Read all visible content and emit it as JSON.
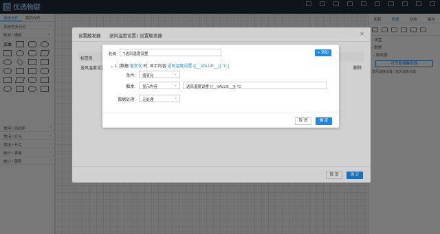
{
  "app": {
    "logo_text": "优选物联",
    "toolbar": [
      {
        "label": "",
        "icon": "undo-icon"
      },
      {
        "label": "",
        "icon": "redo-icon"
      },
      {
        "label": "",
        "icon": "copy-icon"
      },
      {
        "label": "",
        "icon": "paste-icon"
      },
      {
        "label": "",
        "icon": "delete-icon"
      },
      {
        "label": "",
        "icon": "group-icon"
      },
      {
        "label": "",
        "icon": "ungroup-icon"
      },
      {
        "label": "",
        "icon": "preview-icon"
      },
      {
        "label": "",
        "icon": "save-icon"
      },
      {
        "label": "",
        "icon": "publish-icon"
      }
    ]
  },
  "left_panel": {
    "tabs": [
      "系统元件",
      "我的元件"
    ],
    "top_section": "系统常多元件",
    "basic_section": "标准 / 通用",
    "sections": [
      "常用 / 风机柜",
      "常用 / 灯光",
      "常用 / 开关",
      "统计 / 表格",
      "统计 / 图表"
    ]
  },
  "right_panel": {
    "tabs": [
      "面板",
      "数据",
      "动效",
      "操作"
    ],
    "rows": [
      "设置",
      "数据",
      "触发器"
    ],
    "open_button": "打开数据触发器",
    "item": "送风温度设置 / 送风温度设置"
  },
  "dialog_outer": {
    "title": "设置触发器",
    "table_header": "标签名",
    "row_label": "送风温度设置",
    "row_action": "删除",
    "cancel": "取 消",
    "confirm": "确 定"
  },
  "dialog_inner": {
    "title": "送风温度设置 | 设置触发器",
    "name_label": "名称:",
    "name_value": "T送风温度设置",
    "add_button": "+ 添加",
    "rule_prefix": "1. [数据",
    "rule_change": "值变化",
    "rule_mid": "时, 显示内容",
    "rule_content": "送风温度设置 {{__VALUE__}} °C ]",
    "condition_label": "条件:",
    "condition_value": "值变化",
    "trigger_label": "触发:",
    "trigger_value": "显示内容",
    "content_value": "送风温度设置 {{__VALUE__}} °C",
    "process_label": "数据处理:",
    "process_value": "无处理",
    "cancel": "取 消",
    "confirm": "确 定"
  }
}
